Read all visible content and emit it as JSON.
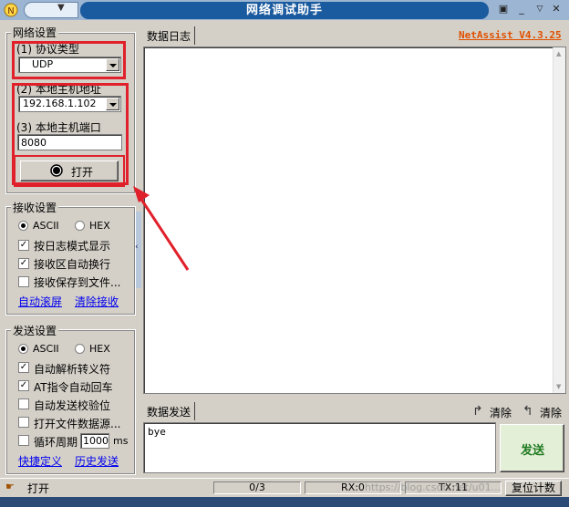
{
  "window": {
    "title": "网络调试助手",
    "version": "NetAssist V4.3.25"
  },
  "network": {
    "group_title": "网络设置",
    "protocol_label": "(1) 协议类型",
    "protocol_value": "UDP",
    "host_label": "(2) 本地主机地址",
    "host_value": "192.168.1.102",
    "port_label": "(3) 本地主机端口",
    "port_value": "8080",
    "open_label": "打开"
  },
  "receive": {
    "group_title": "接收设置",
    "ascii": "ASCII",
    "hex": "HEX",
    "options": [
      "按日志模式显示",
      "接收区自动换行",
      "接收保存到文件..."
    ],
    "options_checked": [
      true,
      true,
      false
    ],
    "links": [
      "自动滚屏",
      "清除接收"
    ]
  },
  "send": {
    "group_title": "发送设置",
    "ascii": "ASCII",
    "hex": "HEX",
    "options": [
      "自动解析转义符",
      "AT指令自动回车",
      "自动发送校验位",
      "打开文件数据源...",
      "循环周期"
    ],
    "options_checked": [
      true,
      true,
      false,
      false,
      false
    ],
    "cycle_value": "1000",
    "cycle_unit": "ms",
    "links": [
      "快捷定义",
      "历史发送"
    ]
  },
  "log": {
    "tab": "数据日志"
  },
  "send_area": {
    "tab": "数据发送",
    "clear1": "清除",
    "clear2": "清除",
    "text": "bye",
    "send_button": "发送"
  },
  "status": {
    "state": "打开",
    "counter": "0/3",
    "rx": "RX:0",
    "tx": "TX:11",
    "reset": "复位计数",
    "watermark": "https://blog.csdn.net/u01..."
  },
  "colors": {
    "title_bar": "#1a5a9e",
    "highlight": "#e0202a",
    "link": "#0000ee",
    "version": "#e05000"
  }
}
